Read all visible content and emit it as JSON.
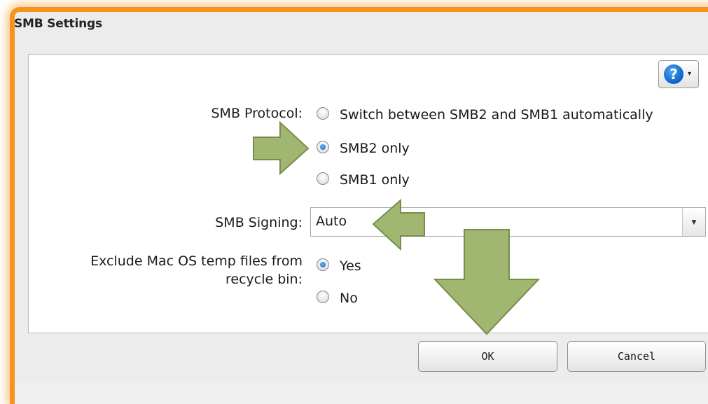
{
  "dialog": {
    "title": "SMB Settings"
  },
  "help": {
    "glyph": "?",
    "caret": "▾"
  },
  "smb_protocol": {
    "label": "SMB Protocol:",
    "options": [
      {
        "label": "Switch between SMB2 and SMB1 automatically",
        "selected": false
      },
      {
        "label": "SMB2 only",
        "selected": true
      },
      {
        "label": "SMB1 only",
        "selected": false
      }
    ]
  },
  "smb_signing": {
    "label": "SMB Signing:",
    "value": "Auto"
  },
  "exclude_mac": {
    "label_line1": "Exclude Mac OS temp files from",
    "label_line2": "recycle bin:",
    "options": [
      {
        "label": "Yes",
        "selected": true
      },
      {
        "label": "No",
        "selected": false
      }
    ]
  },
  "buttons": {
    "ok": "OK",
    "cancel": "Cancel"
  },
  "colors": {
    "frame": "#f7941d",
    "arrow_fill": "#9bb36a",
    "arrow_stroke": "#6f8a40",
    "radio_selected": "#0d5fb8"
  }
}
